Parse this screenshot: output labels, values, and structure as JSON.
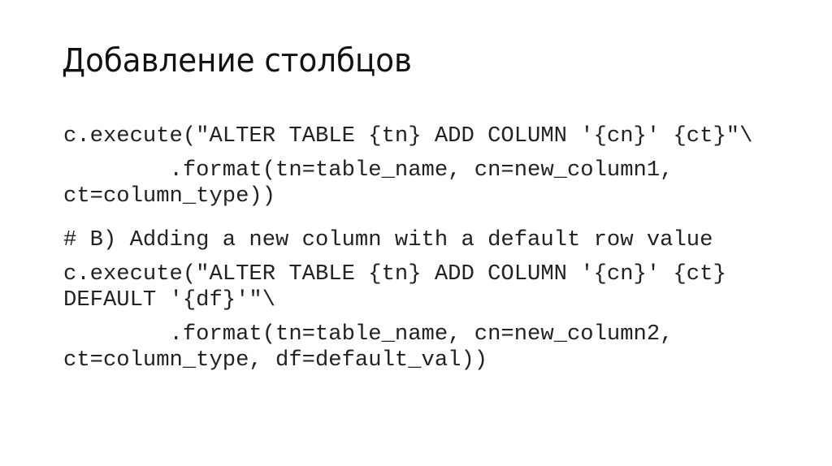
{
  "slide": {
    "title": "Добавление столбцов",
    "paragraphs": [
      "c.execute(\"ALTER TABLE {tn} ADD COLUMN '{cn}' {ct}\"\\",
      "        .format(tn=table_name, cn=new_column1,\nct=column_type))",
      "# B) Adding a new column with a default row value",
      "c.execute(\"ALTER TABLE {tn} ADD COLUMN '{cn}' {ct}\nDEFAULT '{df}'\"\\",
      "        .format(tn=table_name, cn=new_column2,\nct=column_type, df=default_val))"
    ]
  }
}
